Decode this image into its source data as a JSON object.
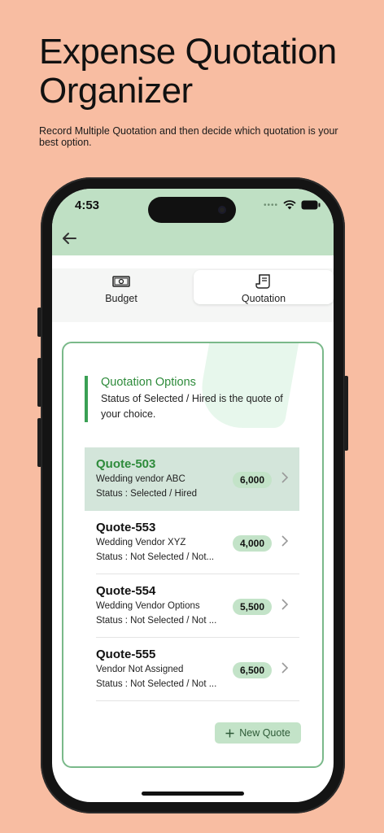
{
  "promo": {
    "title_line1": "Expense Quotation",
    "title_line2": "Organizer",
    "subtitle": "Record Multiple Quotation and then decide which quotation is your best option."
  },
  "status_bar": {
    "time": "4:53"
  },
  "tabs": [
    {
      "label": "Budget",
      "icon": "money-icon",
      "active": false
    },
    {
      "label": "Quotation",
      "icon": "receipt-icon",
      "active": true
    }
  ],
  "info": {
    "title": "Quotation Options",
    "description": "Status of Selected / Hired is the quote of your choice."
  },
  "quotes": [
    {
      "id": "Quote-503",
      "vendor": "Wedding vendor ABC",
      "status": "Status : Selected / Hired",
      "amount": "6,000",
      "selected": true
    },
    {
      "id": "Quote-553",
      "vendor": "Wedding Vendor XYZ",
      "status": "Status : Not Selected / Not...",
      "amount": "4,000",
      "selected": false
    },
    {
      "id": "Quote-554",
      "vendor": "Wedding Vendor Options",
      "status": "Status : Not Selected / Not ...",
      "amount": "5,500",
      "selected": false
    },
    {
      "id": "Quote-555",
      "vendor": "Vendor Not Assigned",
      "status": "Status : Not Selected / Not ...",
      "amount": "6,500",
      "selected": false
    }
  ],
  "new_quote_label": "New Quote",
  "colors": {
    "background": "#f8bda2",
    "header": "#bfe0c4",
    "accent": "#2e8b3b",
    "selected_row": "#d3e5da",
    "badge": "#c3e3c8"
  }
}
